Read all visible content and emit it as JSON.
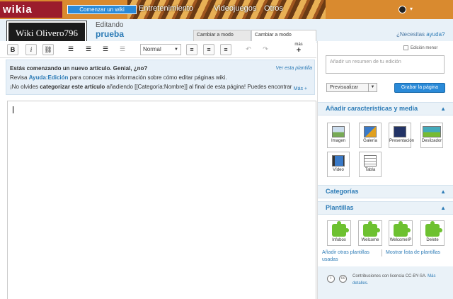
{
  "topbar": {
    "logo": "wikia",
    "start_button": "Comenzar un wiki",
    "nav": [
      "Entretenimiento",
      "Videojuegos",
      "Otros"
    ]
  },
  "header": {
    "wiki_name": "Wiki Olivero796",
    "editing_label": "Editando",
    "page_name": "prueba",
    "tab_source": "Cambiar a modo fuente",
    "tab_wysiwyg": "Cambiar a modo WYSIWYG",
    "help_prefix": "¿Necesitas ",
    "help_link": "ayuda?"
  },
  "toolbar": {
    "bold": "B",
    "italic": "i",
    "format_value": "Normal",
    "more_label": "más",
    "more_plus": "+"
  },
  "notice": {
    "title": "Estás comenzando un nuevo artículo. Genial, ¿no?",
    "line2_prefix": "Revisa ",
    "line2_link": "Ayuda:Edición",
    "line2_suffix": " para conocer más información sobre cómo editar páginas wiki.",
    "line3_prefix": "¡No olvides ",
    "line3_bold": "categorizar este artículo",
    "line3_suffix": " añadiendo [[Categoría:Nombre]] al final de esta página! Puedes encontrar",
    "see_link": "Ver esta plantilla",
    "more_link": "Más +"
  },
  "rail": {
    "minor_edit": "Edición menor",
    "summary_placeholder": "Añadir un resumen de tu edición",
    "preview": "Previsualizar",
    "save": "Grabar la página",
    "features_title": "Añadir características y media",
    "features": [
      "Imagen",
      "Galería",
      "Presentación",
      "Deslizador",
      "Vídeo",
      "Tabla"
    ],
    "categories_title": "Categorías",
    "templates_title": "Plantillas",
    "templates": [
      "Infobox",
      "Welcome",
      "WelcomeIP",
      "Delete"
    ],
    "add_templates": "Añadir otras plantillas usadas",
    "show_templates": "Mostrar lista de plantillas",
    "license_text": "Contribuciones con licencia CC-BY-SA. ",
    "license_link": "Más detalles."
  }
}
